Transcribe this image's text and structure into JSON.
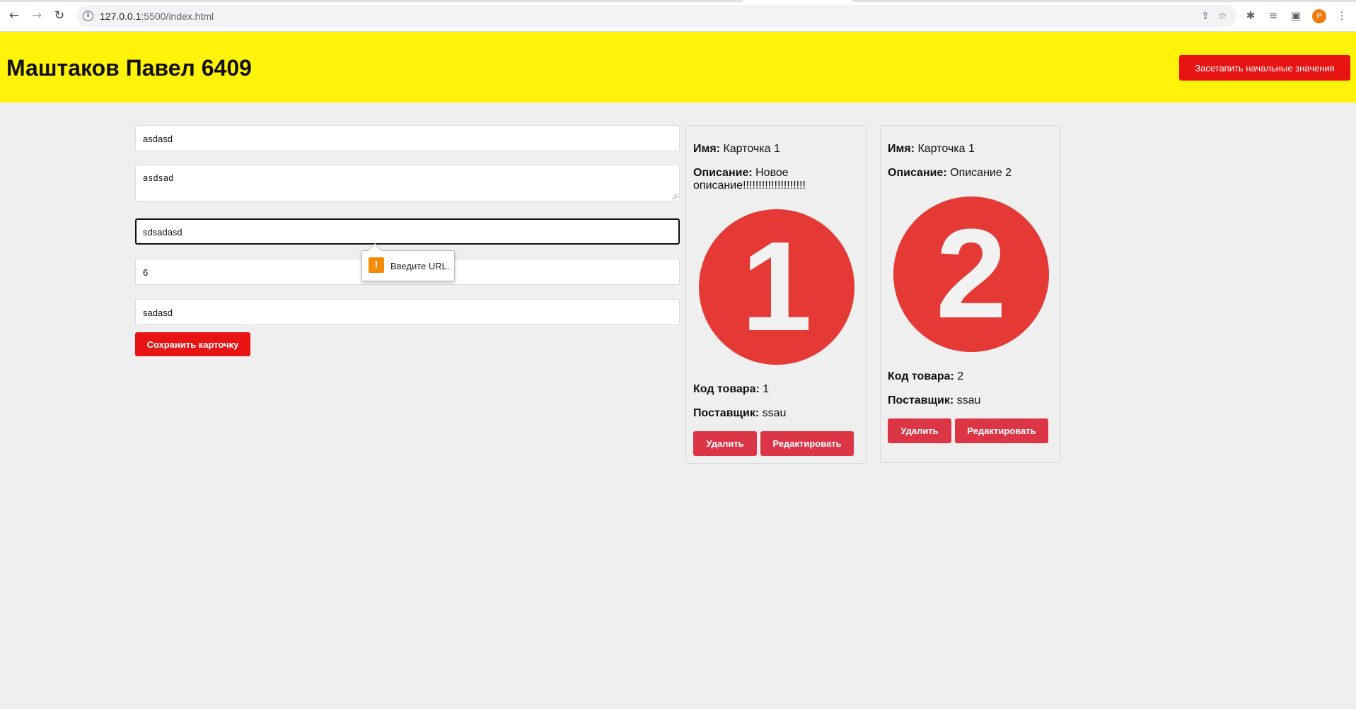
{
  "browser": {
    "url_host": "127.0.0.1",
    "url_path": ":5500/index.html",
    "avatar_letter": "P"
  },
  "header": {
    "title": "Маштаков Павел 6409",
    "reset_button": "Засетапить начальные значения"
  },
  "form": {
    "fields": [
      {
        "name": "name-input",
        "value": "asdasd"
      },
      {
        "name": "description-textarea",
        "value": "asdsad"
      },
      {
        "name": "image-url-input",
        "value": "sdsadasd"
      },
      {
        "name": "product-code-input",
        "value": "6"
      },
      {
        "name": "supplier-input",
        "value": "sadasd"
      }
    ],
    "save_button": "Сохранить карточку",
    "validation_message": "Введите URL."
  },
  "cards": [
    {
      "name_label": "Имя:",
      "name_value": " Карточка 1",
      "desc_label": "Описание:",
      "desc_value": " Новое описание!!!!!!!!!!!!!!!!!!!!",
      "image_number": "1",
      "code_label": "Код товара:",
      "code_value": " 1",
      "supplier_label": "Поставщик:",
      "supplier_value": " ssau",
      "delete_button": "Удалить",
      "edit_button": "Редактировать"
    },
    {
      "name_label": "Имя:",
      "name_value": " Карточка 1",
      "desc_label": "Описание:",
      "desc_value": " Описание 2",
      "image_number": "2",
      "code_label": "Код товара:",
      "code_value": " 2",
      "supplier_label": "Поставщик:",
      "supplier_value": " ssau",
      "delete_button": "Удалить",
      "edit_button": "Редактировать"
    }
  ],
  "colors": {
    "header_bg": "#fff30a",
    "primary_red": "#e81414",
    "card_button": "#dc3545",
    "circle": "#e53935"
  }
}
